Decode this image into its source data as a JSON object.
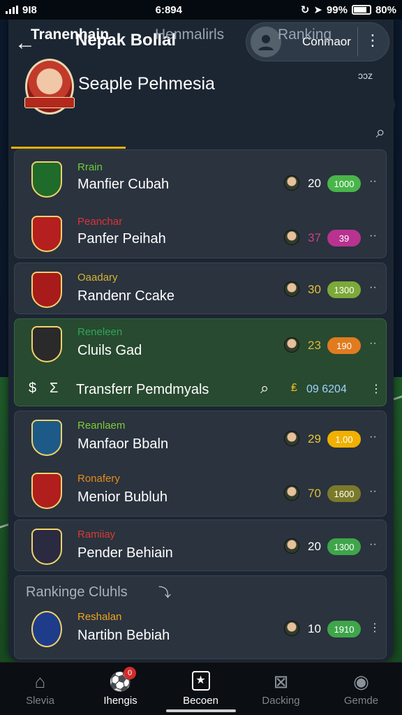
{
  "status_bar": {
    "left_text": "9I8",
    "time": "6:894",
    "battery_text": "99%",
    "extra_text": "80%"
  },
  "header": {
    "app_title": "Nepak Bollal",
    "user_name": "Conmaor",
    "profile_name": "Seaple Pehmesia",
    "profile_extra": "ɔɔz"
  },
  "tabs": [
    {
      "label": "Tranenhain"
    },
    {
      "label": "Henmalirls"
    },
    {
      "label": "Ranking"
    }
  ],
  "clubs": [
    {
      "category": "Rrain",
      "category_color": "#6ecb3d",
      "name": "Manfier Cubah",
      "number": "20",
      "badge": "1000",
      "badge_color": "#49b54a",
      "num_color": "#ffffff"
    },
    {
      "category": "Peanchar",
      "category_color": "#e0323a",
      "name": "Panfer Peihah",
      "number": "37",
      "badge": "39",
      "badge_color": "#b8338f",
      "num_color": "#cc3f8a"
    },
    {
      "category": "Oaadary",
      "category_color": "#d6b431",
      "name": "Randenr Ccake",
      "number": "30",
      "badge": "1300",
      "badge_color": "#7ca93a",
      "num_color": "#e2c13a"
    },
    {
      "category": "Reneleen",
      "category_color": "#2fa65a",
      "name": "Cluils Gad",
      "number": "23",
      "badge": "190",
      "badge_color": "#e17b1f",
      "num_color": "#e3b43c"
    },
    {
      "category": "Reanlaem",
      "category_color": "#7ecb35",
      "name": "Manfaor Bbaln",
      "number": "29",
      "badge": "1.00",
      "badge_color": "#f0b000",
      "num_color": "#e8c535"
    },
    {
      "category": "Ronafery",
      "category_color": "#e68a1d",
      "name": "Menior Bubluh",
      "number": "70",
      "badge": "1600",
      "badge_color": "#7a7a2a",
      "num_color": "#d8c038"
    },
    {
      "category": "Ramiiay",
      "category_color": "#d93a36",
      "name": "Pender Behiain",
      "number": "20",
      "badge": "1300",
      "badge_color": "#3fa54a",
      "num_color": "#ffffff"
    },
    {
      "category": "Reshalan",
      "category_color": "#f0a41e",
      "name": "Nartibn Bebiah",
      "number": "10",
      "badge": "1910",
      "badge_color": "#3fa54a",
      "num_color": "#ffffff"
    }
  ],
  "transfer": {
    "label": "Transferr Pemdmyals",
    "value": "09 6204"
  },
  "ranking_section": {
    "title": "Rankinge Cluhls"
  },
  "nav": [
    {
      "label": "Slevia",
      "icon": "home-icon"
    },
    {
      "label": "Ihengis",
      "icon": "ball-icon",
      "badge": "0"
    },
    {
      "label": "Becoen",
      "icon": "card-icon"
    },
    {
      "label": "Dacking",
      "icon": "grid-icon"
    },
    {
      "label": "Gemde",
      "icon": "globe-icon"
    }
  ]
}
